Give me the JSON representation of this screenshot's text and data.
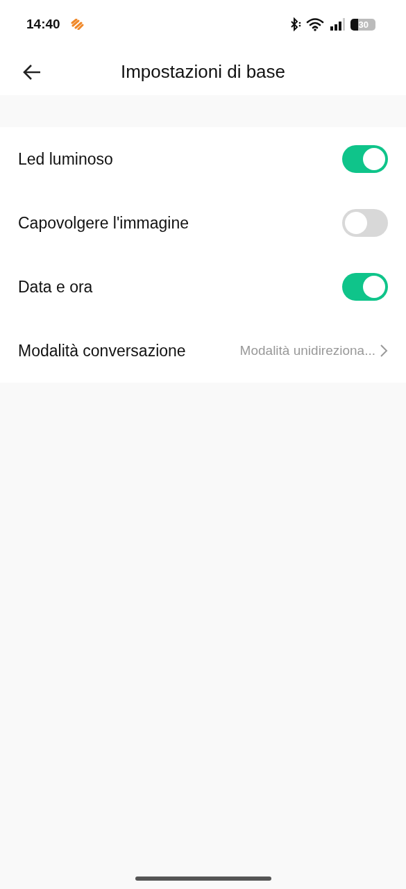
{
  "status_bar": {
    "time": "14:40",
    "battery": "30"
  },
  "header": {
    "title": "Impostazioni di base"
  },
  "settings": [
    {
      "kind": "toggle",
      "label": "Led luminoso",
      "on": true
    },
    {
      "kind": "toggle",
      "label": "Capovolgere l'immagine",
      "on": false
    },
    {
      "kind": "toggle",
      "label": "Data e ora",
      "on": true
    },
    {
      "kind": "link",
      "label": "Modalità conversazione",
      "value": "Modalità unidireziona..."
    }
  ]
}
